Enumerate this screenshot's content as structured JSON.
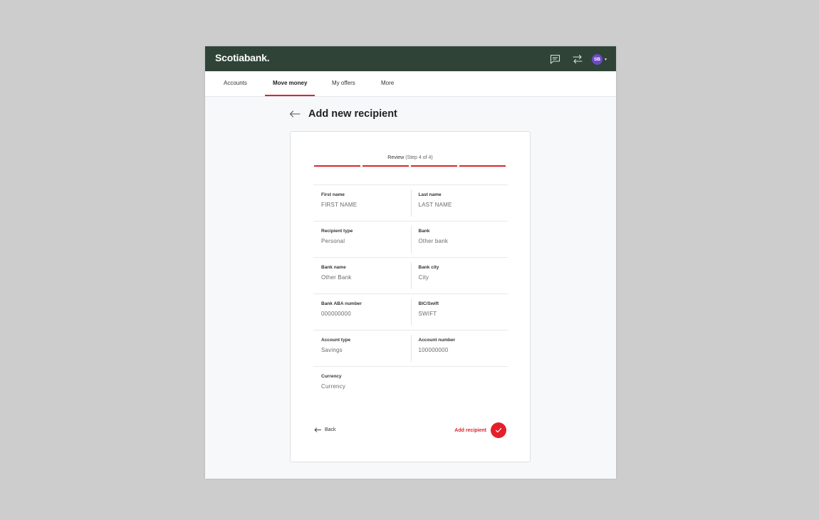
{
  "header": {
    "logo": "Scotiabank.",
    "icons": [
      "chat-icon",
      "transfer-icon"
    ],
    "avatar_initials": "SB"
  },
  "nav": {
    "items": [
      {
        "label": "Accounts"
      },
      {
        "label": "Move money"
      },
      {
        "label": "My offers"
      },
      {
        "label": "More"
      }
    ],
    "active": "Move money"
  },
  "page": {
    "title": "Add new recipient"
  },
  "stepper": {
    "label": "Review",
    "sub": "(Step 4 of 4)",
    "current": 4,
    "total": 4
  },
  "fields": {
    "first_name": {
      "label": "First name",
      "value": "FIRST NAME"
    },
    "last_name": {
      "label": "Last name",
      "value": "LAST NAME"
    },
    "recipient_type": {
      "label": "Recipient type",
      "value": "Personal"
    },
    "bank": {
      "label": "Bank",
      "value": "Other bank"
    },
    "bank_name": {
      "label": "Bank name",
      "value": "Other Bank"
    },
    "bank_city": {
      "label": "Bank city",
      "value": "City"
    },
    "aba": {
      "label": "Bank ABA number",
      "value": "000000000"
    },
    "swift": {
      "label": "BIC/Swift",
      "value": "SWIFT"
    },
    "account_type": {
      "label": "Account type",
      "value": "Savings"
    },
    "account_number": {
      "label": "Account number",
      "value": "100000000"
    },
    "currency": {
      "label": "Currency",
      "value": "Currency"
    }
  },
  "footer": {
    "back_label": "Back",
    "add_label": "Add recipient"
  },
  "colors": {
    "header_bg": "#2f4437",
    "accent_red": "#d8262f",
    "avatar_bg": "#6e48c8"
  }
}
